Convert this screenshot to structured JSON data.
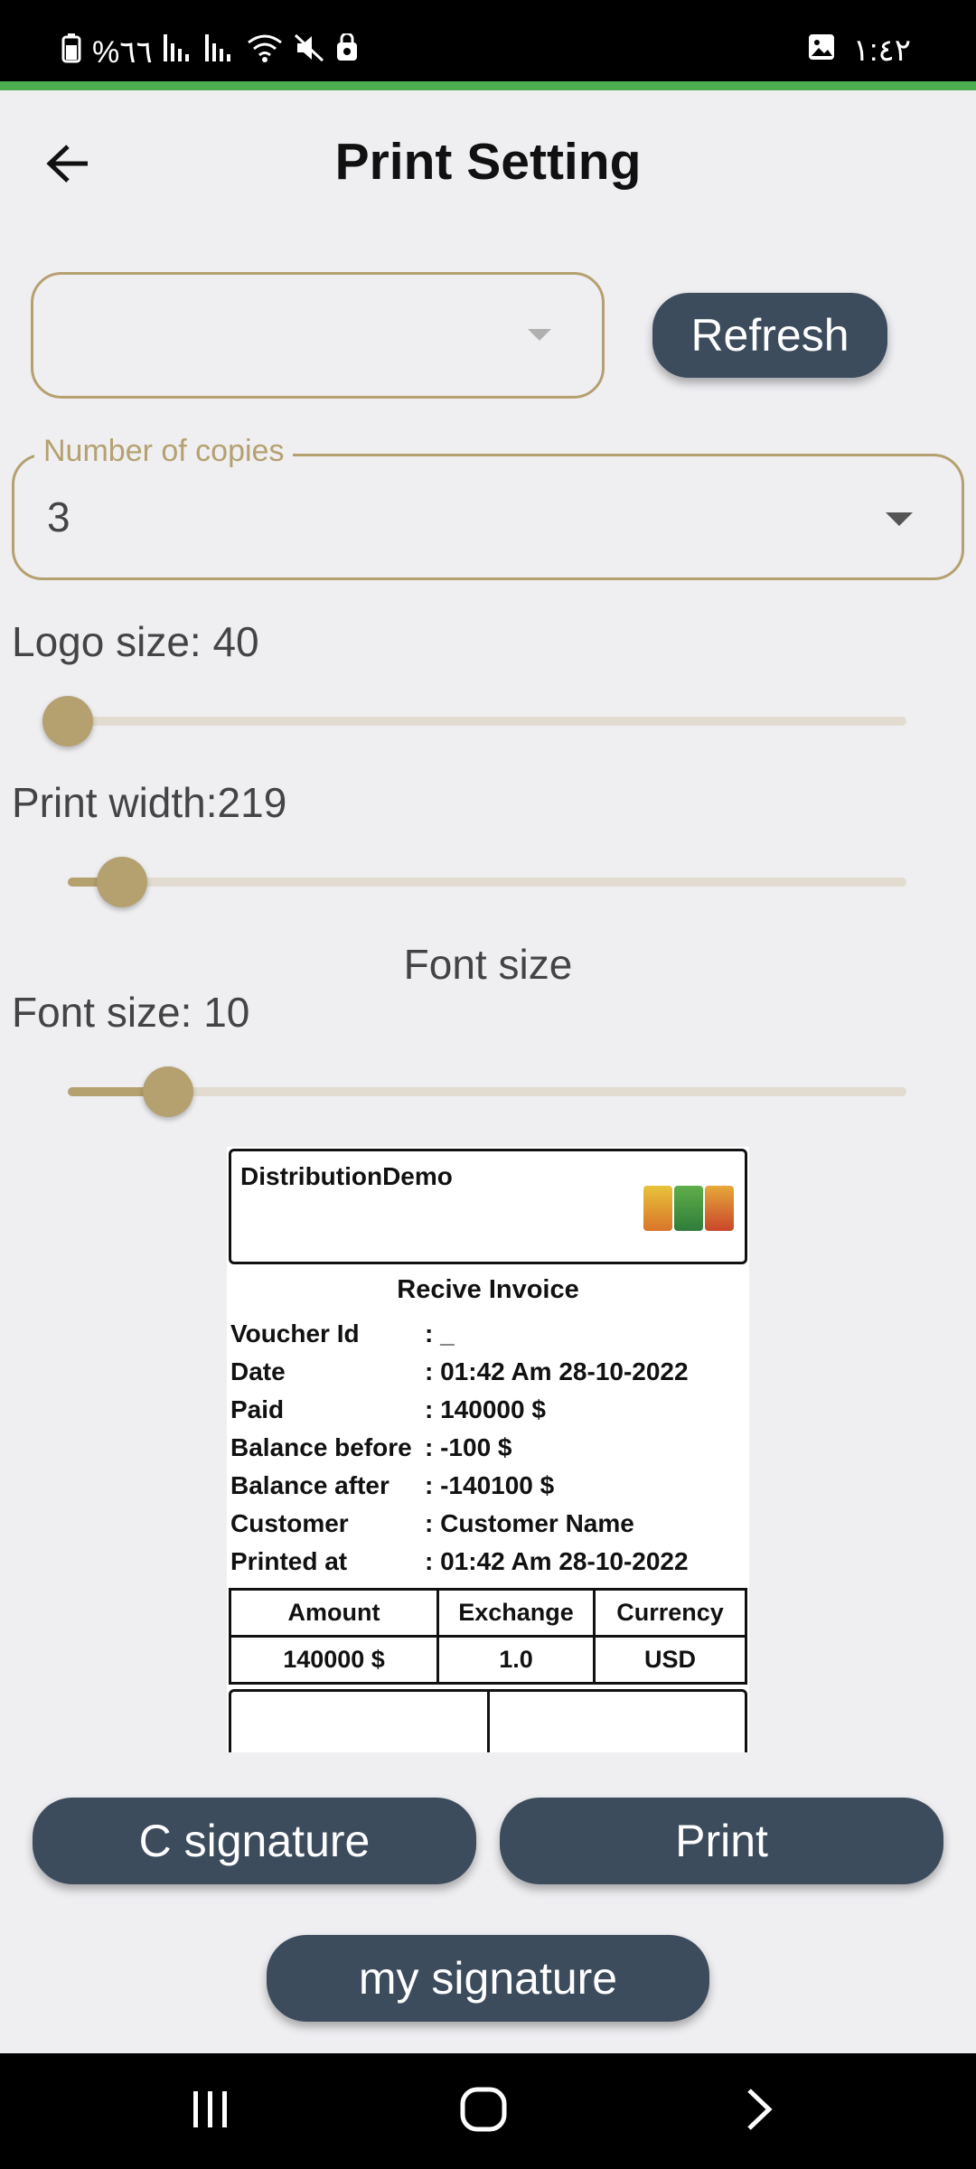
{
  "status_bar": {
    "battery": "%٦٦",
    "time": "١:٤٢"
  },
  "header": {
    "title": "Print Setting",
    "back_icon": "arrow-left-icon"
  },
  "printer_select": {
    "value": "",
    "refresh_label": "Refresh"
  },
  "copies": {
    "label": "Number of copies",
    "value": "3"
  },
  "logo_size": {
    "label": "Logo size: 40",
    "fraction": 0.0
  },
  "print_width": {
    "label": "Print width:219",
    "fraction": 0.065
  },
  "font_section": {
    "heading": "Font size"
  },
  "font_size": {
    "label": "Font size: 10",
    "fraction": 0.12
  },
  "receipt": {
    "company": "DistributionDemo",
    "title": "Recive Invoice",
    "rows": [
      {
        "label": "Voucher Id",
        "value": ": _"
      },
      {
        "label": "Date",
        "value": ": 01:42 Am 28-10-2022"
      },
      {
        "label": "Paid",
        "value": ": 140000 $"
      },
      {
        "label": "Balance before",
        "value": ": -100 $"
      },
      {
        "label": "Balance after",
        "value": ": -140100 $"
      },
      {
        "label": "Customer",
        "value": ": Customer Name"
      },
      {
        "label": "Printed at",
        "value": ": 01:42 Am 28-10-2022"
      }
    ],
    "table": {
      "headers": [
        "Amount",
        "Exchange",
        "Currency"
      ],
      "row": [
        "140000 $",
        "1.0",
        "USD"
      ]
    }
  },
  "actions": {
    "c_signature": "C signature",
    "print": "Print",
    "my_signature": "my signature"
  },
  "colors": {
    "accent": "#b5a16f",
    "button": "#3c4c5d",
    "strip": "#4cae4f"
  }
}
